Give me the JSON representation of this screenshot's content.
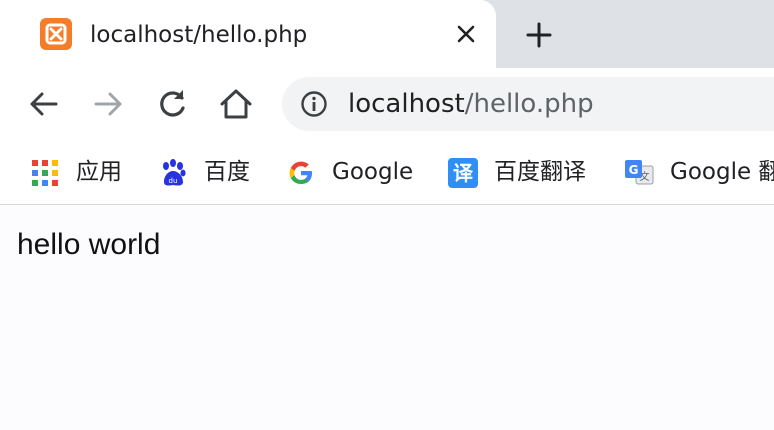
{
  "tab": {
    "title": "localhost/hello.php",
    "favicon": "xampp-icon",
    "close_icon": "close-icon",
    "new_tab_icon": "plus-icon"
  },
  "toolbar": {
    "back_icon": "back-arrow-icon",
    "forward_icon": "forward-arrow-icon",
    "reload_icon": "reload-icon",
    "home_icon": "home-icon",
    "info_icon": "info-icon",
    "url_host": "localhost",
    "url_path": "/hello.php"
  },
  "bookmarks": [
    {
      "label": "应用",
      "icon": "apps-grid-icon"
    },
    {
      "label": "百度",
      "icon": "baidu-paw-icon"
    },
    {
      "label": "Google",
      "icon": "google-g-icon"
    },
    {
      "label": "百度翻译",
      "icon": "baidu-translate-icon"
    },
    {
      "label": "Google 翻",
      "icon": "google-translate-icon"
    }
  ],
  "page": {
    "text": "hello world"
  },
  "colors": {
    "tabstrip_bg": "#dee1e6",
    "omnibox_bg": "#f1f3f4",
    "xampp_orange": "#f47d2a",
    "translate_blue": "#2f8ff5",
    "baidu_blue": "#2932e1"
  }
}
